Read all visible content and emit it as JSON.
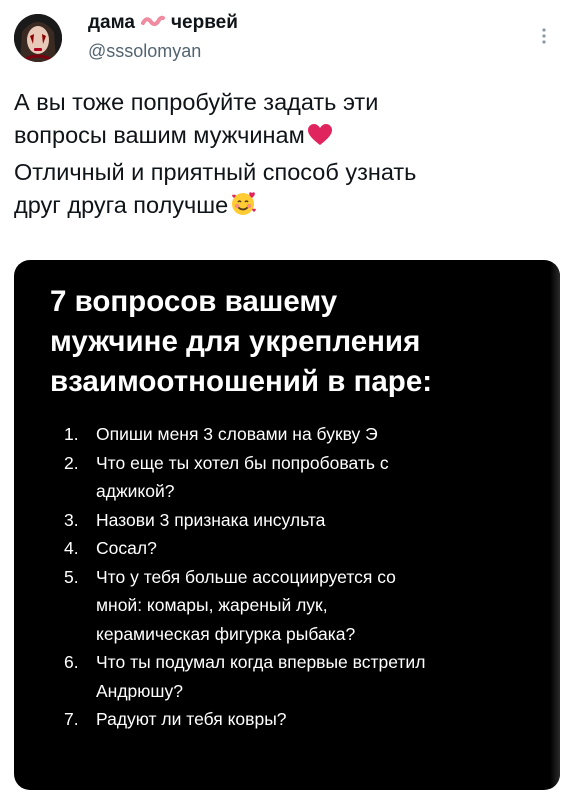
{
  "author": {
    "display_name_part1": "дама",
    "display_name_part2": "червей",
    "handle": "@sssolomyan"
  },
  "tweet": {
    "lines": [
      "А вы тоже попробуйте задать эти",
      "вопросы вашим мужчинам",
      "Отличный и приятный способ узнать",
      "друг друга получше"
    ]
  },
  "media": {
    "title_lines": [
      "7 вопросов вашему",
      "мужчине для укрепления",
      "взаимоотношений в паре:"
    ],
    "questions": [
      {
        "num": "1.",
        "lines": [
          "Опиши меня 3 словами на букву Э"
        ]
      },
      {
        "num": "2.",
        "lines": [
          "Что еще ты хотел бы попробовать с",
          "аджикой?"
        ]
      },
      {
        "num": "3.",
        "lines": [
          "Назови 3 признака инсульта"
        ]
      },
      {
        "num": "4.",
        "lines": [
          "Сосал?"
        ]
      },
      {
        "num": "5.",
        "lines": [
          "Что у тебя больше ассоциируется со",
          "мной: комары, жареный лук,",
          "керамическая фигурка рыбака?"
        ]
      },
      {
        "num": "6.",
        "lines": [
          "Что ты подумал когда впервые встретил",
          "Андрюшу?"
        ]
      },
      {
        "num": "7.",
        "lines": [
          "Радуют ли тебя ковры?"
        ]
      }
    ]
  },
  "icons": {
    "worm": "worm-emoji-icon",
    "heart": "red-heart-emoji-icon",
    "smiling_hearts": "smiling-face-with-hearts-emoji-icon",
    "more": "more-options-icon"
  },
  "colors": {
    "text": "#0f1419",
    "secondary_text": "#536471",
    "heart": "#e0245e",
    "media_bg": "#000000"
  }
}
